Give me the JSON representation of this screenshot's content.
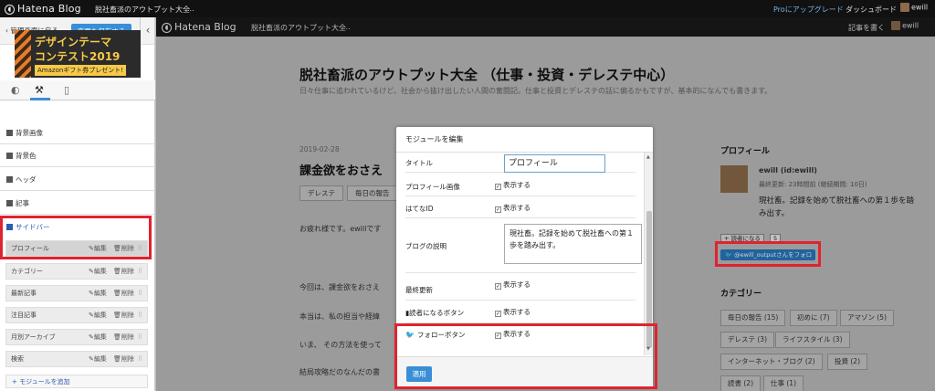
{
  "topbar": {
    "logo": "Hatena Blog",
    "blog_name": "脱社畜派のアウトプット大全",
    "more": "...",
    "pro_link": "Proにアップグレード",
    "dashboard": "ダッシュボード",
    "user": "ewill"
  },
  "sidebar": {
    "back_label": "管理画面に戻る",
    "save_label": "変更を保存する",
    "banner": {
      "line1": "デザインテーマ",
      "line2": "コンテスト2019",
      "line3": "Amazonギフト券プレゼント!"
    },
    "sections": [
      "背景画像",
      "背景色",
      "ヘッダ",
      "記事",
      "サイドバー"
    ],
    "modules": [
      {
        "name": "プロフィール",
        "edit": "編集",
        "delete": "削除"
      },
      {
        "name": "カテゴリー",
        "edit": "編集",
        "delete": "削除"
      },
      {
        "name": "最新記事",
        "edit": "編集",
        "delete": "削除"
      },
      {
        "name": "注目記事",
        "edit": "編集",
        "delete": "削除"
      },
      {
        "name": "月別アーカイブ",
        "edit": "編集",
        "delete": "削除"
      },
      {
        "name": "検索",
        "edit": "編集",
        "delete": "削除"
      }
    ],
    "add_module": "+ モジュールを追加"
  },
  "preview": {
    "logo": "Hatena Blog",
    "blog_name": "脱社畜派のアウトプット大全",
    "more": "...",
    "write": "記事を書く",
    "user": "ewill",
    "title": "脱社畜派のアウトプット大全 （仕事・投資・デレステ中心）",
    "description": "日々仕事に追われているけど、社会から抜け出したい人間の奮闘記。仕事と投資とデレステの話に偏るかもですが、基本的になんでも書きます。",
    "date": "2019-02-28",
    "entry_title": "課金欲をおさえ",
    "tags": [
      "デレステ",
      "毎日の報告"
    ],
    "paragraphs": [
      "お疲れ様です。ewillです",
      "今回は、課金欲をおさえ",
      "本当は、私の担当や経緯",
      "いま、 その方法を使って",
      "結局攻略だのなんだの書"
    ],
    "profile": {
      "heading": "プロフィール",
      "name": "ewill (id:ewill)",
      "meta": "最終更新: 23時間前 (継続期間: 10日)",
      "intro": "現社畜。記録を始めて脱社畜への第１歩を踏み出す。",
      "reader_btn": "+ 読者になる",
      "reader_count": "5",
      "follow_btn": "@ewill_outputさんをフォロー"
    },
    "categories": {
      "heading": "カテゴリー",
      "items": [
        "毎日の報告 (15)",
        "初めに (7)",
        "アマゾン (5)",
        "デレステ (3)",
        "ライフスタイル (3)",
        "インターネット・ブログ (2)",
        "投資 (2)",
        "読書 (2)",
        "仕事 (1)"
      ]
    }
  },
  "modal": {
    "title": "モジュールを編集",
    "fields": {
      "title_label": "タイトル",
      "title_value": "プロフィール",
      "image_label": "プロフィール画像",
      "hatena_id_label": "はてなID",
      "desc_label": "ブログの説明",
      "desc_value": "現社畜。記録を始めて脱社畜への第１歩を踏み出す。",
      "updated_label": "最終更新",
      "reader_label": "読者になるボタン",
      "follow_label": "フォローボタン",
      "show": "表示する"
    },
    "apply": "適用"
  }
}
